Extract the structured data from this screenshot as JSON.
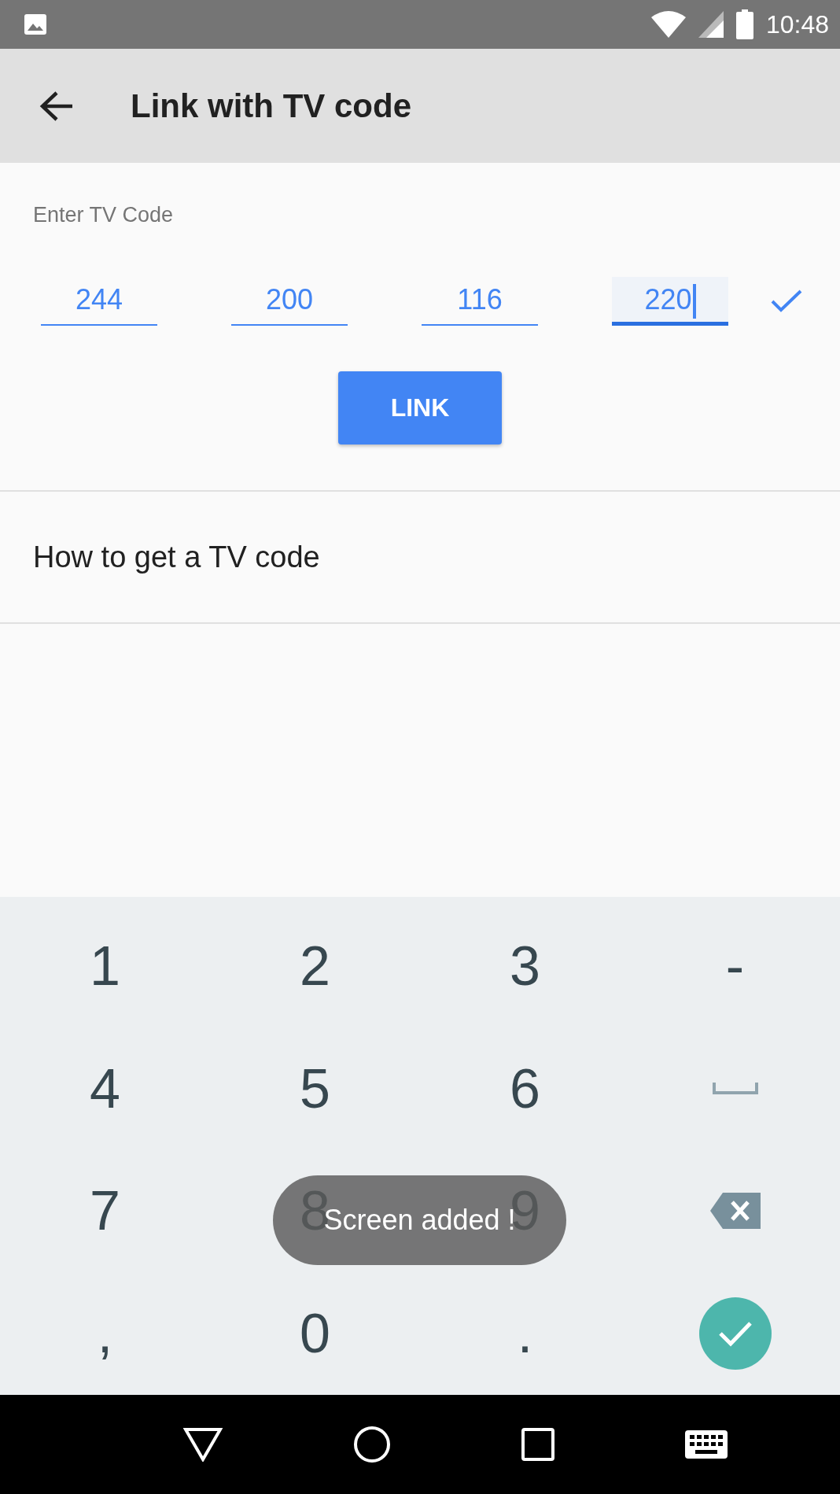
{
  "status_bar": {
    "time": "10:48"
  },
  "app_bar": {
    "title": "Link with TV code"
  },
  "code_form": {
    "label": "Enter TV Code",
    "fields": [
      {
        "value": "244",
        "focused": false
      },
      {
        "value": "200",
        "focused": false
      },
      {
        "value": "116",
        "focused": false
      },
      {
        "value": "220",
        "focused": true
      }
    ],
    "button": "LINK"
  },
  "help_link": "How to get a TV code",
  "keyboard": {
    "keys": [
      {
        "kind": "char",
        "label": "1"
      },
      {
        "kind": "char",
        "label": "2"
      },
      {
        "kind": "char",
        "label": "3"
      },
      {
        "kind": "char",
        "label": "-"
      },
      {
        "kind": "char",
        "label": "4"
      },
      {
        "kind": "char",
        "label": "5"
      },
      {
        "kind": "char",
        "label": "6"
      },
      {
        "kind": "space"
      },
      {
        "kind": "char",
        "label": "7"
      },
      {
        "kind": "char",
        "label": "8"
      },
      {
        "kind": "char",
        "label": "9"
      },
      {
        "kind": "backspace"
      },
      {
        "kind": "char",
        "label": ","
      },
      {
        "kind": "char",
        "label": "0"
      },
      {
        "kind": "char",
        "label": "."
      },
      {
        "kind": "done"
      }
    ]
  },
  "toast": "Screen added !"
}
